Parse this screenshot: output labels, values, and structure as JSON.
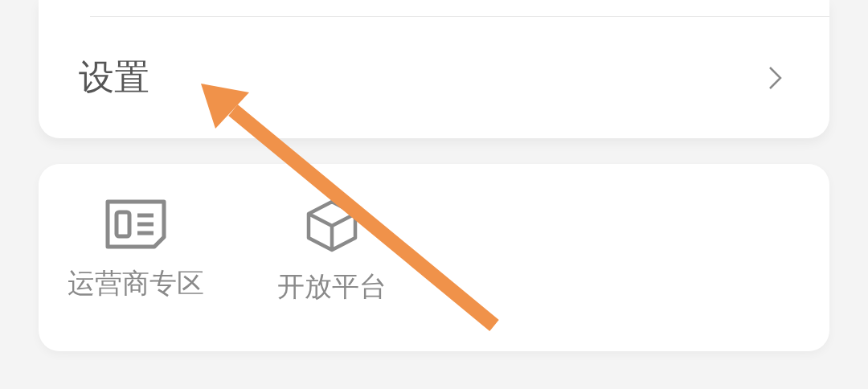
{
  "settings_card": {
    "items": [
      {
        "label": "设置"
      }
    ]
  },
  "shortcuts": [
    {
      "label": "运营商专区",
      "kind": "sim"
    },
    {
      "label": "开放平台",
      "kind": "cube"
    }
  ],
  "annotation": {
    "kind": "arrow"
  }
}
